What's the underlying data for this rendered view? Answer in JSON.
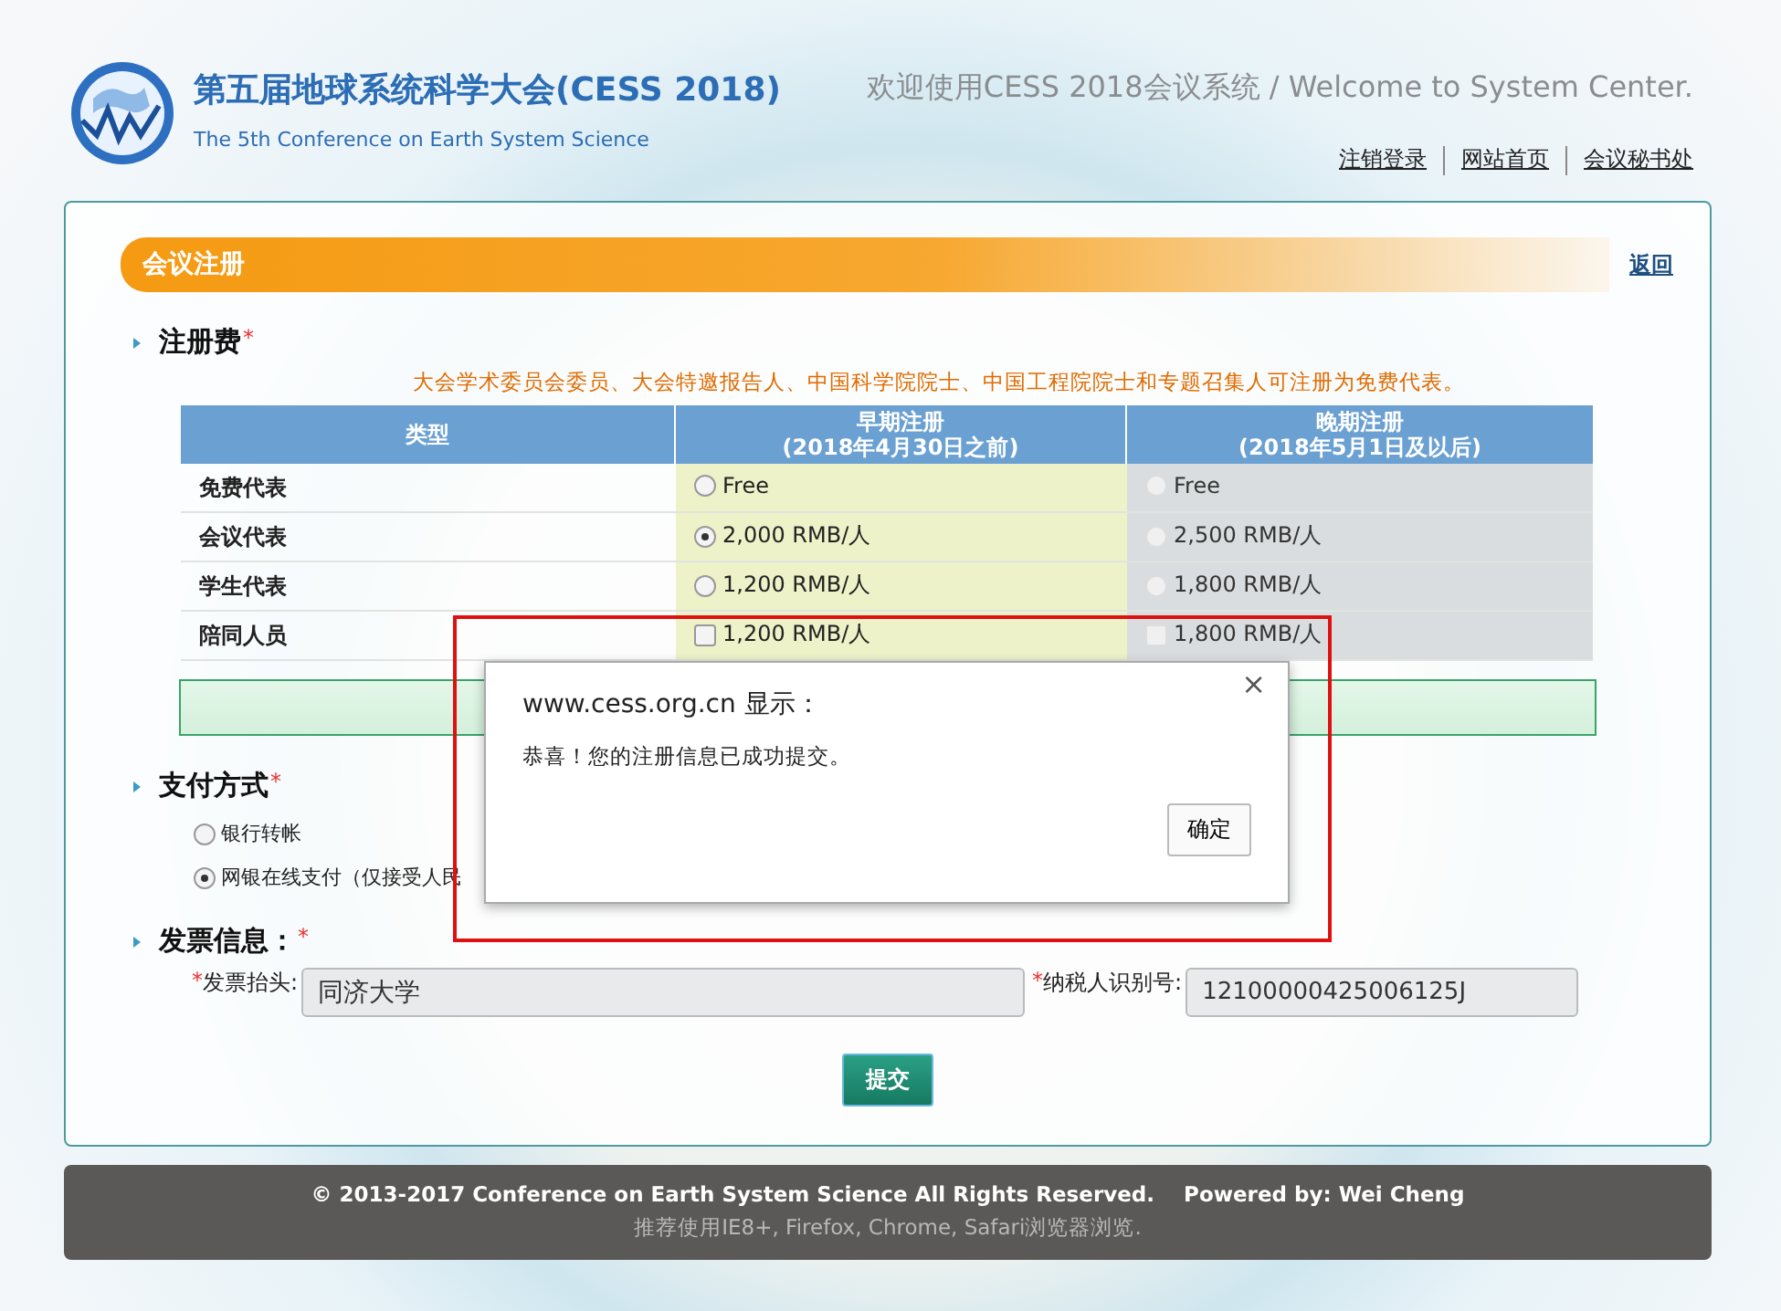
{
  "header": {
    "title": "第五届地球系统科学大会(CESS 2018)",
    "subtitle": "The 5th Conference on Earth System Science",
    "welcome": "欢迎使用CESS 2018会议系统 / Welcome to System Center.",
    "links": [
      {
        "label": "注销登录"
      },
      {
        "label": "网站首页"
      },
      {
        "label": "会议秘书处"
      }
    ]
  },
  "panel": {
    "title": "会议注册",
    "back_link": "返回"
  },
  "fee": {
    "label": "注册费",
    "required": "*",
    "note": "大会学术委员会委员、大会特邀报告人、中国科学院院士、中国工程院院士和专题召集人可注册为免费代表。",
    "columns": [
      {
        "title": "类型"
      },
      {
        "title": "早期注册",
        "subtitle": "(2018年4月30日之前)"
      },
      {
        "title": "晚期注册",
        "subtitle": "(2018年5月1日及以后)"
      }
    ],
    "rows": [
      {
        "type": "免费代表",
        "kind": "radio",
        "early": {
          "price": "Free",
          "selected": false,
          "disabled": false
        },
        "late": {
          "price": "Free",
          "selected": false,
          "disabled": true
        }
      },
      {
        "type": "会议代表",
        "kind": "radio",
        "early": {
          "price": "2,000 RMB/人",
          "selected": true,
          "disabled": false
        },
        "late": {
          "price": "2,500 RMB/人",
          "selected": false,
          "disabled": true
        }
      },
      {
        "type": "学生代表",
        "kind": "radio",
        "early": {
          "price": "1,200 RMB/人",
          "selected": false,
          "disabled": false
        },
        "late": {
          "price": "1,800 RMB/人",
          "selected": false,
          "disabled": true
        }
      },
      {
        "type": "陪同人员",
        "kind": "checkbox",
        "early": {
          "price": "1,200 RMB/人",
          "checked": false,
          "disabled": false
        },
        "late": {
          "price": "1,800 RMB/人",
          "checked": false,
          "disabled": true
        }
      }
    ]
  },
  "payment": {
    "label": "支付方式",
    "required": "*",
    "options": [
      {
        "label": "银行转帐",
        "selected": false
      },
      {
        "label": "网银在线支付（仅接受人民",
        "selected": true
      }
    ]
  },
  "invoice": {
    "label": "发票信息：",
    "required": "*",
    "fields": [
      {
        "required": "*",
        "label": "发票抬头:",
        "value": "同济大学"
      },
      {
        "required": "*",
        "label": "纳税人识别号:",
        "value": "12100000425006125J"
      }
    ]
  },
  "submit_button": "提交",
  "footer": {
    "copyright": "© 2013-2017 Conference on Earth System Science All Rights Reserved.    Powered by: Wei Cheng",
    "browsers": "推荐使用IE8+, Firefox, Chrome, Safari浏览器浏览."
  },
  "dialog": {
    "origin": "www.cess.org.cn 显示：",
    "message": "恭喜！您的注册信息已成功提交。",
    "close": "×",
    "ok_button": "确定"
  }
}
